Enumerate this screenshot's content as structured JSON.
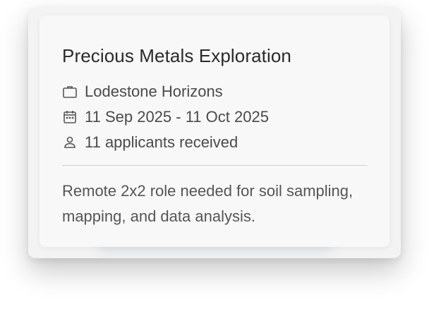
{
  "job": {
    "title": "Precious Metals Exploration",
    "company": "Lodestone Horizons",
    "date_range": "11 Sep 2025 - 11 Oct 2025",
    "applicants": "11 applicants received",
    "description": "Remote 2x2 role needed for soil sampling, mapping, and data analysis."
  },
  "icons": {
    "company": "briefcase-icon",
    "date": "calendar-icon",
    "applicants": "person-icon"
  },
  "colors": {
    "card_background": "#f8f8f8",
    "text_primary": "#2b2b2b",
    "text_secondary": "#4a4a4a",
    "divider": "#cfcfcf"
  }
}
